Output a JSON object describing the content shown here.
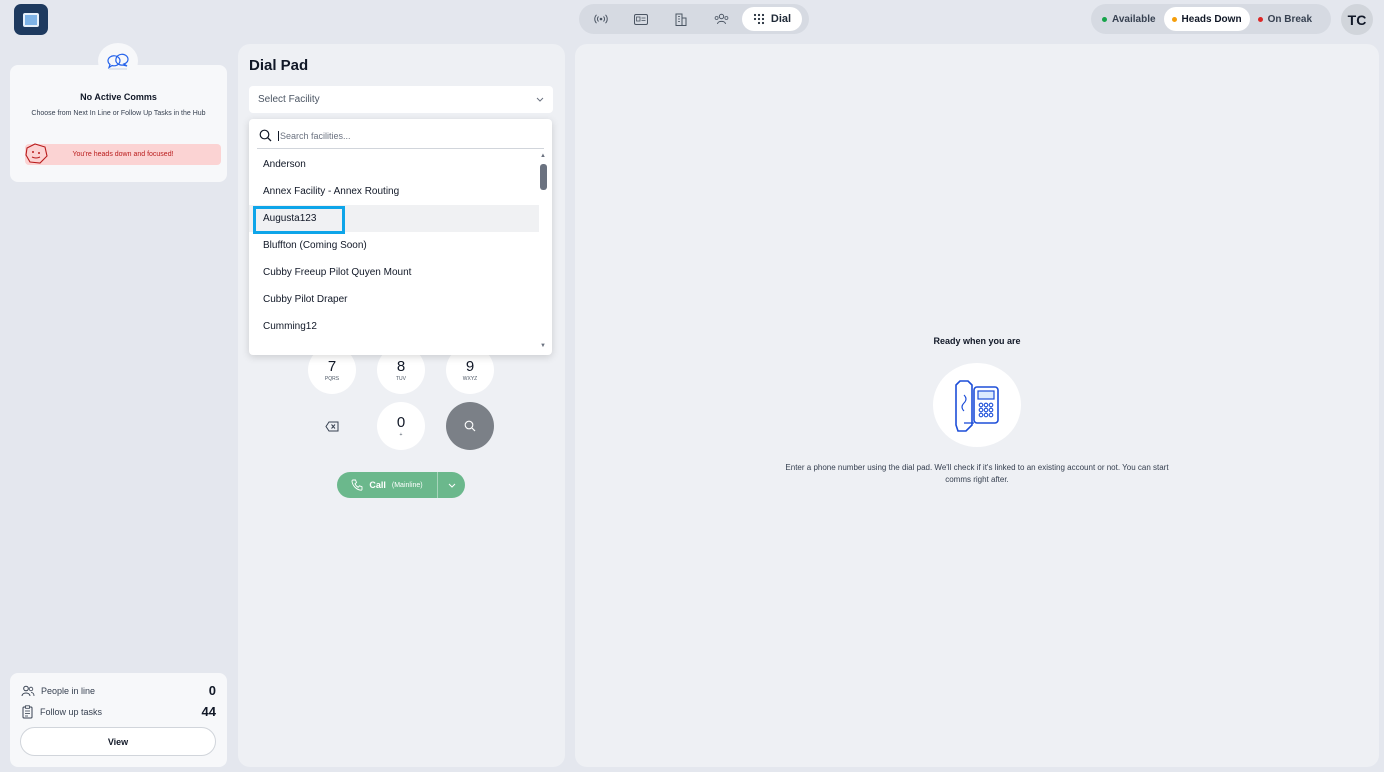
{
  "app": {
    "user_initials": "TC"
  },
  "topnav": {
    "items": [
      {
        "icon": "broadcast-icon"
      },
      {
        "icon": "id-card-icon"
      },
      {
        "icon": "building-icon"
      },
      {
        "icon": "people-icon"
      },
      {
        "icon": "dialpad-icon",
        "label": "Dial",
        "active": true
      }
    ]
  },
  "status": {
    "available": {
      "label": "Available",
      "color": "#16a34a"
    },
    "heads_down": {
      "label": "Heads Down",
      "color": "#f59e0b",
      "active": true
    },
    "on_break": {
      "label": "On Break",
      "color": "#dc2626"
    }
  },
  "comms": {
    "title": "No Active Comms",
    "subtitle": "Choose from Next In Line or Follow Up Tasks in the Hub",
    "heads_down_msg": "You're heads down and focused!"
  },
  "stats": {
    "people_in_line_label": "People in line",
    "people_in_line": "0",
    "follow_up_label": "Follow up tasks",
    "follow_up": "44",
    "view_label": "View"
  },
  "dialpad": {
    "title": "Dial Pad",
    "select_placeholder": "Select Facility",
    "search_placeholder": "Search facilities...",
    "facilities": [
      "Anderson",
      "Annex Facility - Annex Routing",
      "Augusta123",
      "Bluffton (Coming Soon)",
      "Cubby Freeup Pilot Quyen Mount",
      "Cubby Pilot Draper",
      "Cumming12"
    ],
    "highlighted": "Augusta123",
    "keys": [
      {
        "digit": "7",
        "letters": "PQRS"
      },
      {
        "digit": "8",
        "letters": "TUV"
      },
      {
        "digit": "9",
        "letters": "WXYZ"
      },
      {
        "digit": "0",
        "letters": "+"
      }
    ],
    "call_label": "Call",
    "call_line": "(Mainline)"
  },
  "ready": {
    "title": "Ready when you are",
    "description": "Enter a phone number using the dial pad. We'll check if it's linked to an existing account or not. You can start comms right after."
  }
}
